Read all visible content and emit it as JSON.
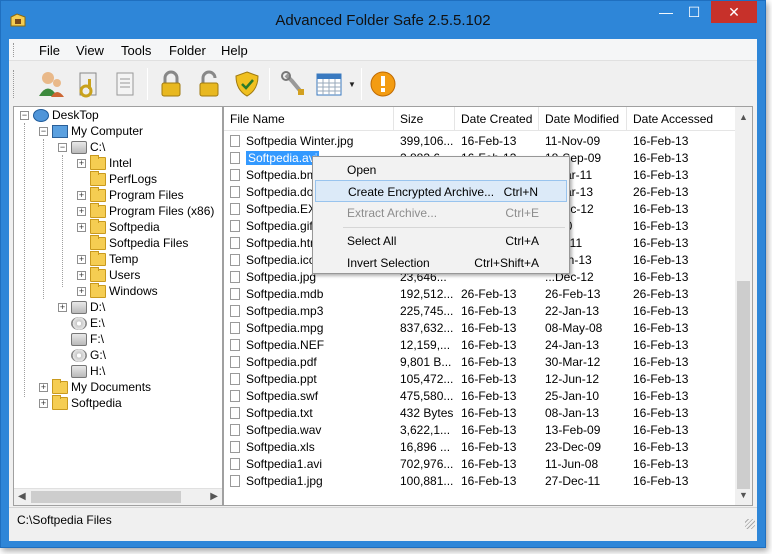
{
  "window": {
    "title": "Advanced Folder Safe 2.5.5.102",
    "controls": {
      "minimize": "—",
      "maximize": "☐",
      "close": "✕"
    }
  },
  "menu": [
    "File",
    "View",
    "Tools",
    "Folder",
    "Help"
  ],
  "toolbar": {
    "icons": [
      "users-icon",
      "key-card-icon",
      "document-icon",
      "lock-icon",
      "unlock-icon",
      "shield-icon",
      "wrench-icon",
      "calendar-grid-icon",
      "warning-icon"
    ]
  },
  "tree": {
    "items": [
      {
        "label": "DeskTop",
        "icon": "desktop-icon"
      },
      {
        "label": "My Computer",
        "icon": "computer-icon"
      },
      {
        "label": "C:\\",
        "icon": "drive-icon"
      },
      {
        "label": "Intel",
        "icon": "folder-icon"
      },
      {
        "label": "PerfLogs",
        "icon": "folder-icon"
      },
      {
        "label": "Program Files",
        "icon": "folder-icon"
      },
      {
        "label": "Program Files (x86)",
        "icon": "folder-icon"
      },
      {
        "label": "Softpedia",
        "icon": "folder-icon"
      },
      {
        "label": "Softpedia Files",
        "icon": "folder-icon"
      },
      {
        "label": "Temp",
        "icon": "folder-icon"
      },
      {
        "label": "Users",
        "icon": "folder-icon"
      },
      {
        "label": "Windows",
        "icon": "folder-icon"
      },
      {
        "label": "D:\\",
        "icon": "drive-icon"
      },
      {
        "label": "E:\\",
        "icon": "disc-icon"
      },
      {
        "label": "F:\\",
        "icon": "drive-icon"
      },
      {
        "label": "G:\\",
        "icon": "disc-icon"
      },
      {
        "label": "H:\\",
        "icon": "drive-icon"
      },
      {
        "label": "My Documents",
        "icon": "documents-icon"
      },
      {
        "label": "Softpedia",
        "icon": "folder-icon"
      }
    ]
  },
  "list": {
    "columns": [
      "File Name",
      "Size",
      "Date Created",
      "Date Modified",
      "Date Accessed"
    ],
    "rows": [
      [
        "Softpedia Winter.jpg",
        "399,106...",
        "16-Feb-13",
        "11-Nov-09",
        "16-Feb-13"
      ],
      [
        "Softpedia.avi",
        "2,883,6...",
        "16-Feb-13",
        "18-Sep-09",
        "16-Feb-13"
      ],
      [
        "Softpedia.bmp",
        "",
        "",
        "...Mar-11",
        "16-Feb-13"
      ],
      [
        "Softpedia.doc",
        "",
        "",
        "...Mar-13",
        "26-Feb-13"
      ],
      [
        "Softpedia.EXE",
        "",
        "",
        "...Dec-12",
        "16-Feb-13"
      ],
      [
        "Softpedia.gif",
        "",
        "",
        "...-10",
        "16-Feb-13"
      ],
      [
        "Softpedia.html",
        "",
        "",
        "...or-11",
        "16-Feb-13"
      ],
      [
        "Softpedia.ico",
        "",
        "",
        "...Jan-13",
        "16-Feb-13"
      ],
      [
        "Softpedia.jpg",
        "23,646...",
        "",
        "...Dec-12",
        "16-Feb-13"
      ],
      [
        "Softpedia.mdb",
        "192,512...",
        "26-Feb-13",
        "26-Feb-13",
        "26-Feb-13"
      ],
      [
        "Softpedia.mp3",
        "225,745...",
        "16-Feb-13",
        "22-Jan-13",
        "16-Feb-13"
      ],
      [
        "Softpedia.mpg",
        "837,632...",
        "16-Feb-13",
        "08-May-08",
        "16-Feb-13"
      ],
      [
        "Softpedia.NEF",
        "12,159,...",
        "16-Feb-13",
        "24-Jan-13",
        "16-Feb-13"
      ],
      [
        "Softpedia.pdf",
        "9,801 B...",
        "16-Feb-13",
        "30-Mar-12",
        "16-Feb-13"
      ],
      [
        "Softpedia.ppt",
        "105,472...",
        "16-Feb-13",
        "12-Jun-12",
        "16-Feb-13"
      ],
      [
        "Softpedia.swf",
        "475,580...",
        "16-Feb-13",
        "25-Jan-10",
        "16-Feb-13"
      ],
      [
        "Softpedia.txt",
        "432 Bytes",
        "16-Feb-13",
        "08-Jan-13",
        "16-Feb-13"
      ],
      [
        "Softpedia.wav",
        "3,622,1...",
        "16-Feb-13",
        "13-Feb-09",
        "16-Feb-13"
      ],
      [
        "Softpedia.xls",
        "16,896 ...",
        "16-Feb-13",
        "23-Dec-09",
        "16-Feb-13"
      ],
      [
        "Softpedia1.avi",
        "702,976...",
        "16-Feb-13",
        "11-Jun-08",
        "16-Feb-13"
      ],
      [
        "Softpedia1.jpg",
        "100,881...",
        "16-Feb-13",
        "27-Dec-11",
        "16-Feb-13"
      ]
    ],
    "selected_index": 1
  },
  "context_menu": {
    "items": [
      {
        "label": "Open",
        "shortcut": ""
      },
      {
        "label": "Create Encrypted Archive...",
        "shortcut": "Ctrl+N"
      },
      {
        "label": "Extract Archive...",
        "shortcut": "Ctrl+E"
      },
      {
        "label": "Select All",
        "shortcut": "Ctrl+A"
      },
      {
        "label": "Invert Selection",
        "shortcut": "Ctrl+Shift+A"
      }
    ]
  },
  "status": {
    "path": "C:\\Softpedia Files"
  },
  "colors": {
    "titlebar": "#2e86d8",
    "close_button": "#c7312a",
    "selection": "#3399ff",
    "menu_highlight": "#dceaf8"
  }
}
